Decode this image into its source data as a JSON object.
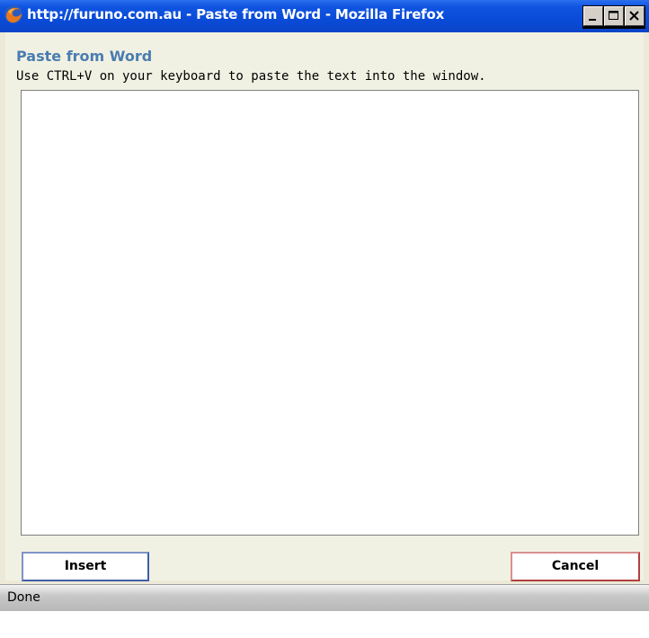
{
  "window": {
    "title": "http://furuno.com.au - Paste from Word - Mozilla Firefox",
    "buttons": [
      "minimize-icon",
      "maximize-icon",
      "close-icon"
    ]
  },
  "dialog": {
    "title": "Paste from Word",
    "instructions": "Use CTRL+V on your keyboard to paste the text into the window.",
    "paste_area_value": ""
  },
  "actions": {
    "insert_label": "Insert",
    "cancel_label": "Cancel"
  },
  "status": {
    "text": "Done"
  },
  "colors": {
    "titlebar": "#0a4bd8",
    "dialog_title": "#4a7cb0",
    "insert_border": "#3d5ea8",
    "cancel_border": "#b04040"
  }
}
